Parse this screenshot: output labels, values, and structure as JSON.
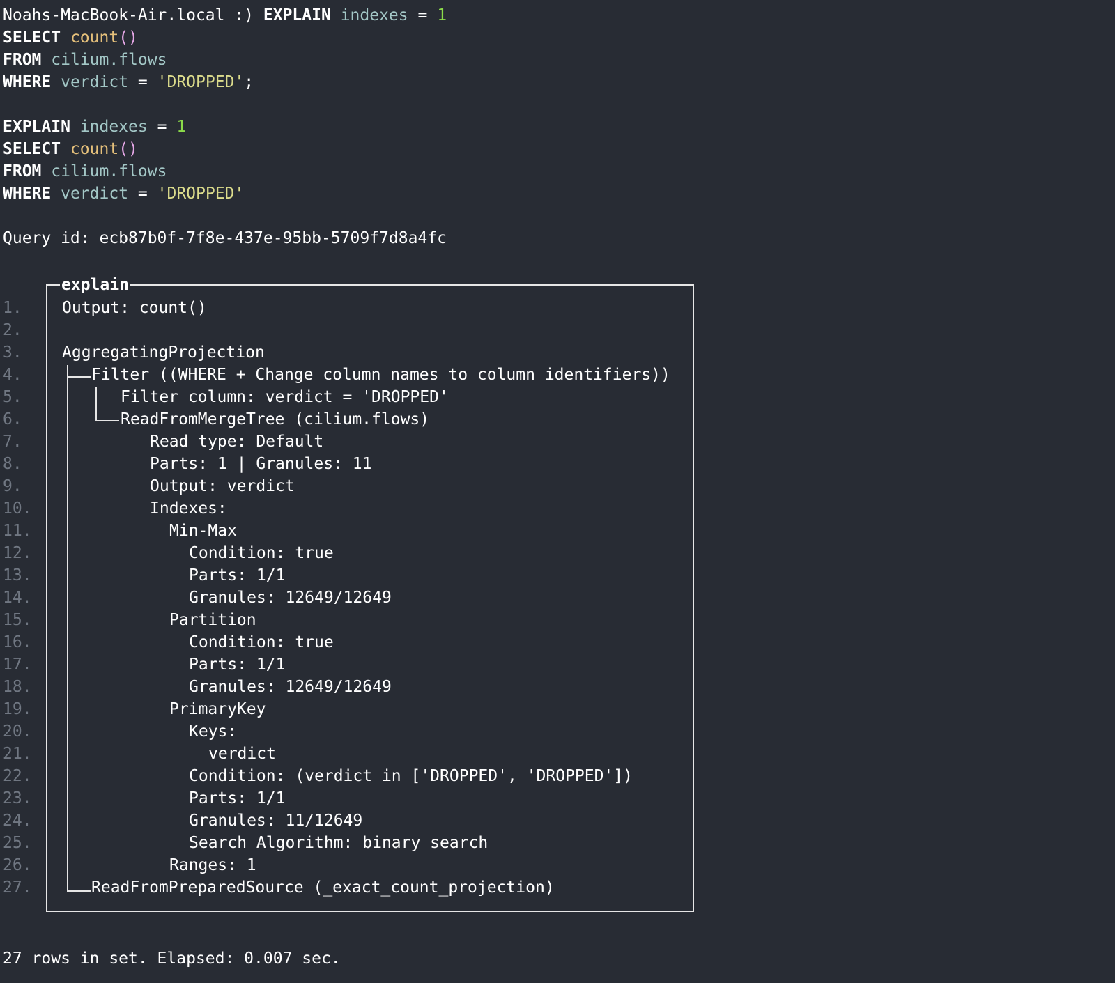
{
  "prompt": {
    "host": "Noahs-MacBook-Air.local :)",
    "explain_kw": "EXPLAIN",
    "explain_param": "indexes",
    "eq": "=",
    "explain_value": "1"
  },
  "query1": {
    "select_kw": "SELECT",
    "select_fn": "count",
    "select_parens": "()",
    "from_kw": "FROM",
    "from_table": "cilium.flows",
    "where_kw": "WHERE",
    "where_col": "verdict",
    "where_eq": "=",
    "where_val": "'DROPPED'",
    "terminator": ";"
  },
  "query2": {
    "explain_kw": "EXPLAIN",
    "explain_param": "indexes",
    "eq": "=",
    "explain_value": "1",
    "select_kw": "SELECT",
    "select_fn": "count",
    "select_parens": "()",
    "from_kw": "FROM",
    "from_table": "cilium.flows",
    "where_kw": "WHERE",
    "where_col": "verdict",
    "where_eq": "=",
    "where_val": "'DROPPED'"
  },
  "query_id": "Query id: ecb87b0f-7f8e-437e-95bb-5709f7d8a4fc",
  "explain": {
    "title": "explain",
    "rows": [
      {
        "num": "1.",
        "text": "Output: count()"
      },
      {
        "num": "2.",
        "text": ""
      },
      {
        "num": "3.",
        "text": "AggregatingProjection"
      },
      {
        "num": "4.",
        "text": "Filter ((WHERE + Change column names to column identifiers))"
      },
      {
        "num": "5.",
        "text": "Filter column: verdict = 'DROPPED'"
      },
      {
        "num": "6.",
        "text": "ReadFromMergeTree (cilium.flows)"
      },
      {
        "num": "7.",
        "text": "Read type: Default"
      },
      {
        "num": "8.",
        "text": "Parts: 1 | Granules: 11"
      },
      {
        "num": "9.",
        "text": "Output: verdict"
      },
      {
        "num": "10.",
        "text": "Indexes:"
      },
      {
        "num": "11.",
        "text": "Min-Max"
      },
      {
        "num": "12.",
        "text": "Condition: true"
      },
      {
        "num": "13.",
        "text": "Parts: 1/1"
      },
      {
        "num": "14.",
        "text": "Granules: 12649/12649"
      },
      {
        "num": "15.",
        "text": "Partition"
      },
      {
        "num": "16.",
        "text": "Condition: true"
      },
      {
        "num": "17.",
        "text": "Parts: 1/1"
      },
      {
        "num": "18.",
        "text": "Granules: 12649/12649"
      },
      {
        "num": "19.",
        "text": "PrimaryKey"
      },
      {
        "num": "20.",
        "text": "Keys:"
      },
      {
        "num": "21.",
        "text": "verdict"
      },
      {
        "num": "22.",
        "text": "Condition: (verdict in ['DROPPED', 'DROPPED'])"
      },
      {
        "num": "23.",
        "text": "Parts: 1/1"
      },
      {
        "num": "24.",
        "text": "Granules: 11/12649"
      },
      {
        "num": "25.",
        "text": "Search Algorithm: binary search"
      },
      {
        "num": "26.",
        "text": "Ranges: 1"
      },
      {
        "num": "27.",
        "text": "ReadFromPreparedSource (_exact_count_projection)"
      }
    ]
  },
  "footer": "27 rows in set. Elapsed: 0.007 sec."
}
